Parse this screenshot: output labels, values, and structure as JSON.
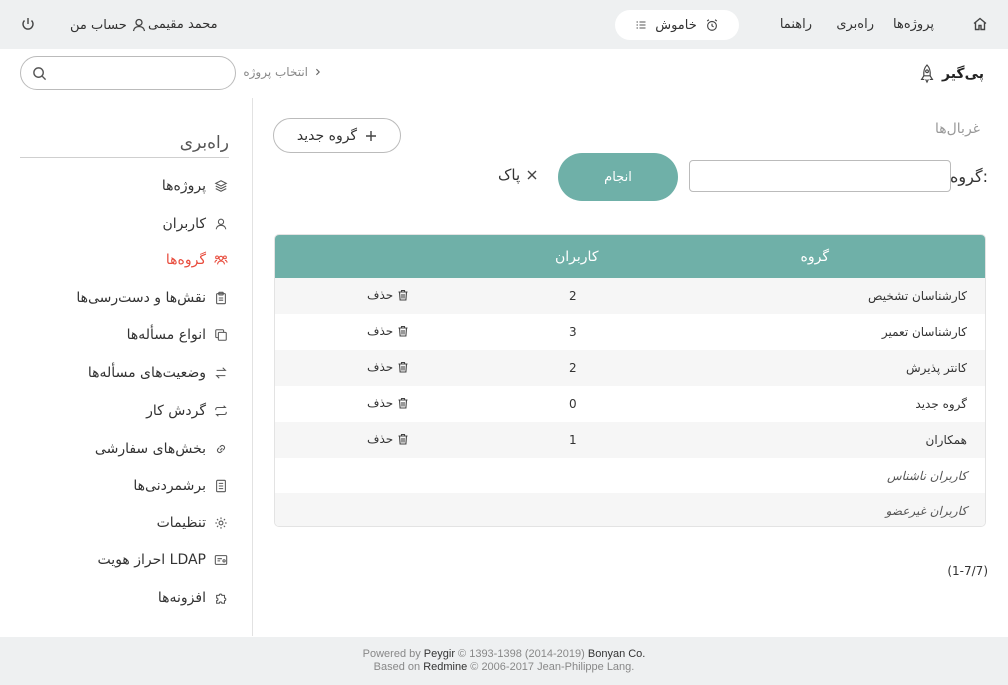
{
  "topbar": {
    "nav_projects": "پروژه‌ها",
    "nav_admin": "راه‌بری",
    "nav_help": "راهنما",
    "silent_label": "خاموش",
    "user_name": "محمد مقیمی",
    "my_account": "حساب من"
  },
  "header": {
    "brand": "پی‌گیر",
    "breadcrumb": "انتخاب پروژه",
    "search_placeholder": ""
  },
  "sidebar": {
    "title": "راه‌بری",
    "items": [
      {
        "label": "پروژه‌ها",
        "icon": "layers-icon"
      },
      {
        "label": "کاربران",
        "icon": "user-icon"
      },
      {
        "label": "گروه‌ها",
        "icon": "group-icon"
      },
      {
        "label": "نقش‌ها و دست‌رسی‌ها",
        "icon": "clipboard-icon"
      },
      {
        "label": "انواع مسأله‌ها",
        "icon": "copy-icon"
      },
      {
        "label": "وضعیت‌های مسأله‌ها",
        "icon": "swap-icon"
      },
      {
        "label": "گردش کار",
        "icon": "repeat-icon"
      },
      {
        "label": "بخش‌های سفارشی",
        "icon": "link-icon"
      },
      {
        "label": "برشمردنی‌ها",
        "icon": "list-icon"
      },
      {
        "label": "تنظیمات",
        "icon": "gear-icon"
      },
      {
        "label": "احراز هویت LDAP",
        "icon": "id-card-icon"
      },
      {
        "label": "افزونه‌ها",
        "icon": "puzzle-icon"
      }
    ]
  },
  "main": {
    "filters_label": "غربال‌ها",
    "group_label": "گروه:",
    "group_value": "",
    "apply_label": "انجام",
    "clear_label": "پاک",
    "new_group_label": "گروه جدید",
    "table": {
      "col_group": "گروه",
      "col_users": "کاربران",
      "delete_label": "حذف",
      "rows": [
        {
          "name": "کارشناسان تشخیص",
          "count": "2"
        },
        {
          "name": "کارشناسان تعمیر",
          "count": "3"
        },
        {
          "name": "کانتر پذیرش",
          "count": "2"
        },
        {
          "name": "گروه جدید",
          "count": "0"
        },
        {
          "name": "همکاران",
          "count": "1"
        }
      ],
      "builtin_rows": [
        {
          "name": "کاربران ناشناس"
        },
        {
          "name": "کاربران غیرعضو"
        }
      ]
    },
    "pagination": "(1-7/7)"
  },
  "footer": {
    "powered_prefix": "Powered by",
    "powered_app": "Peygir",
    "powered_years": "© 1393-1398 (2014-2019)",
    "powered_company": "Bonyan Co.",
    "based_prefix": "Based on",
    "based_app": "Redmine",
    "based_rest": "© 2006-2017 Jean-Philippe Lang."
  },
  "colors": {
    "accent": "#6fb0a8",
    "active_item": "#e84c3d",
    "topbar_bg": "#eef0f1"
  }
}
